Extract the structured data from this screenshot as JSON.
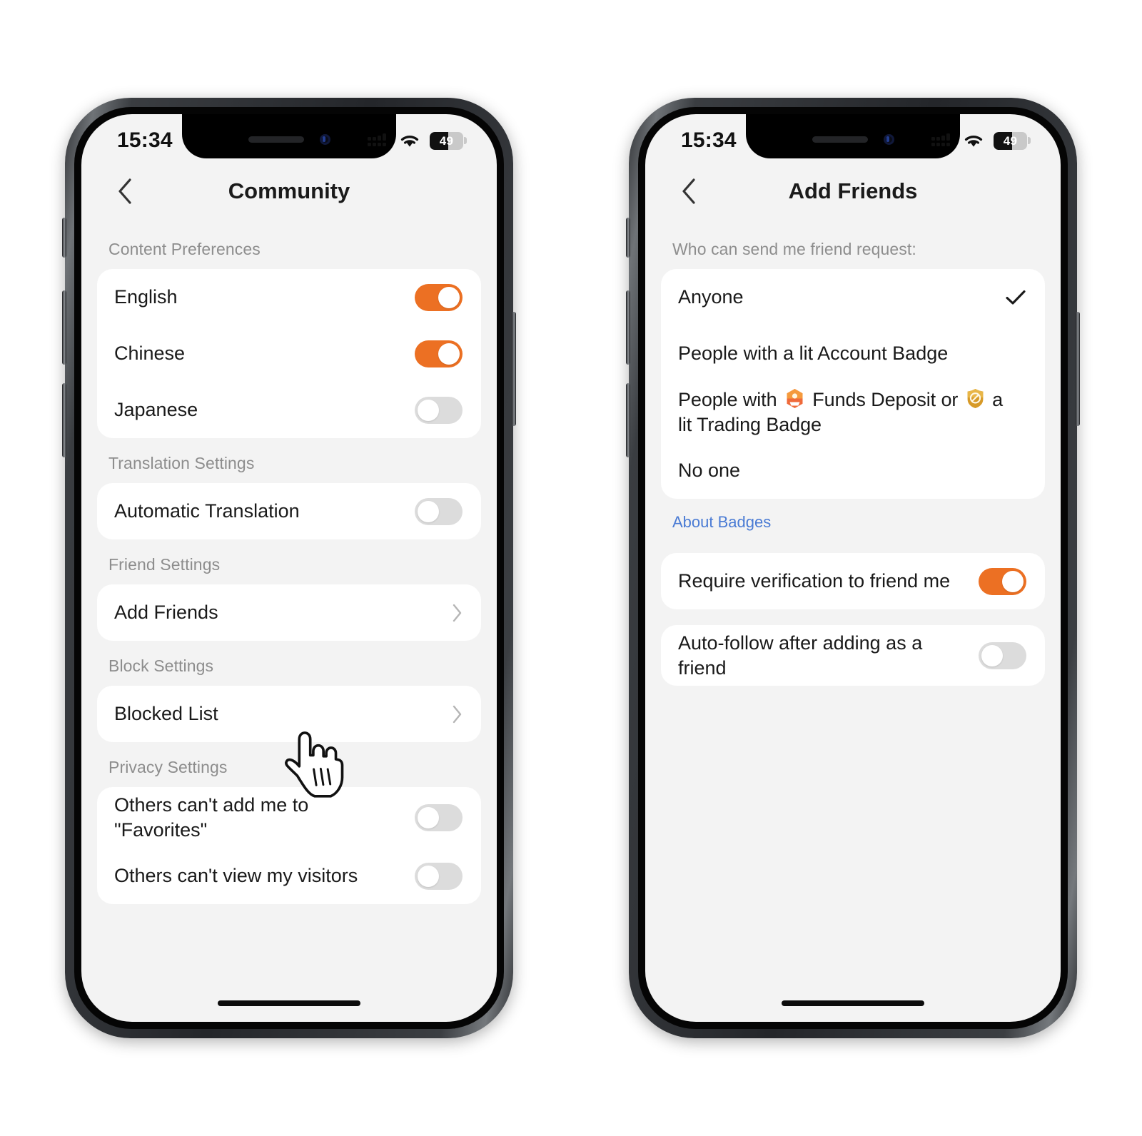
{
  "theme": {
    "accent_orange": "#ec7023",
    "toggle_off_gray": "#dcdcdc",
    "screen_bg": "#f3f3f3",
    "card_bg": "#ffffff",
    "link_blue": "#4a7bd4",
    "label_gray": "#8d8d8d",
    "text_dark": "#1a1a1a",
    "badge_funds_color": "#e8563a",
    "badge_trading_color": "#d79a28"
  },
  "status_bar": {
    "time": "15:34",
    "battery_percent": "49",
    "signal_icon": "cellular-signal-icon",
    "wifi_icon": "wifi-icon",
    "battery_icon": "battery-icon"
  },
  "phone_left": {
    "nav": {
      "back_icon": "chevron-left-icon",
      "title": "Community"
    },
    "sections": [
      {
        "label": "Content Preferences",
        "rows": [
          {
            "label": "English",
            "control": "toggle",
            "state": "on"
          },
          {
            "label": "Chinese",
            "control": "toggle",
            "state": "on"
          },
          {
            "label": "Japanese",
            "control": "toggle",
            "state": "off"
          }
        ]
      },
      {
        "label": "Translation Settings",
        "rows": [
          {
            "label": "Automatic Translation",
            "control": "toggle",
            "state": "off"
          }
        ]
      },
      {
        "label": "Friend Settings",
        "rows": [
          {
            "label": "Add Friends",
            "control": "chevron",
            "state": ""
          }
        ]
      },
      {
        "label": "Block Settings",
        "rows": [
          {
            "label": "Blocked List",
            "control": "chevron",
            "state": ""
          }
        ]
      },
      {
        "label": "Privacy Settings",
        "rows": [
          {
            "label": "Others can't add me to \"Favorites\"",
            "control": "toggle",
            "state": "off"
          },
          {
            "label": "Others can't view my visitors",
            "control": "toggle",
            "state": "off"
          }
        ]
      }
    ]
  },
  "phone_right": {
    "nav": {
      "back_icon": "chevron-left-icon",
      "title": "Add Friends"
    },
    "question_label": "Who can send me friend request:",
    "options": [
      {
        "label": "Anyone",
        "selected": true
      },
      {
        "label": "People with a lit Account Badge",
        "selected": false
      },
      {
        "label_part_1": "People with ",
        "badge_1": "funds-deposit-badge-icon",
        "label_part_2": " Funds Deposit or ",
        "badge_2": "trading-badge-icon",
        "label_part_3": " a lit Trading Badge",
        "selected": false
      },
      {
        "label": "No one",
        "selected": false
      }
    ],
    "about_badges_link": "About Badges",
    "switch_rows": [
      {
        "label": "Require verification to friend me",
        "state": "on"
      },
      {
        "label": "Auto-follow after adding as a friend",
        "state": "off"
      }
    ]
  },
  "cursor": {
    "icon": "pointing-hand-cursor",
    "target": "Add Friends"
  }
}
